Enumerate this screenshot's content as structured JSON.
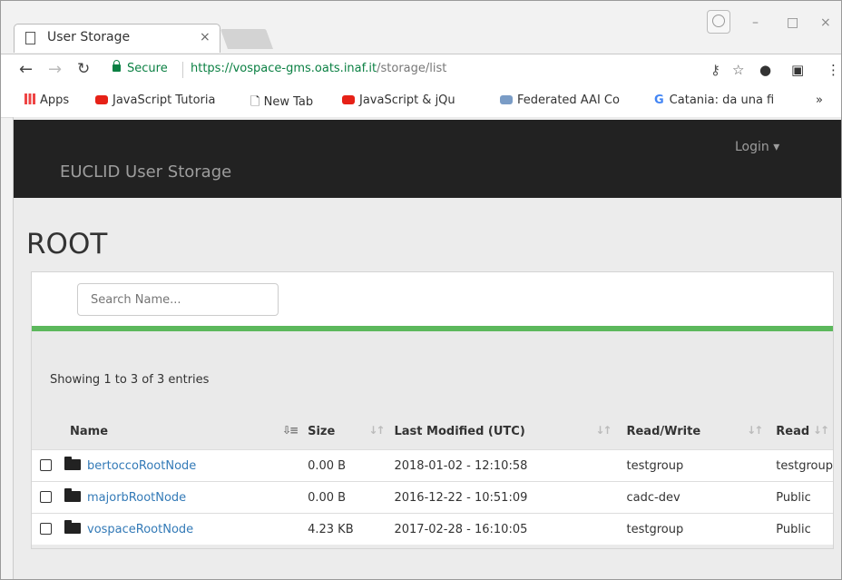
{
  "browser": {
    "tab_title": "User Storage",
    "tab_close": "×",
    "minimize": "–",
    "maximize": "□",
    "close": "×",
    "secure_label": "Secure",
    "url_host": "https://vospace-gms.oats.inaf.it",
    "url_path": "/storage/list",
    "bookmarks": [
      {
        "label": "Apps",
        "icon": "apps-icon"
      },
      {
        "label": "JavaScript Tutoria",
        "icon": "youtube-icon"
      },
      {
        "label": "New Tab",
        "icon": "page-icon"
      },
      {
        "label": "JavaScript & jQu",
        "icon": "youtube-icon"
      },
      {
        "label": "Federated AAI Co",
        "icon": "cloud-icon"
      },
      {
        "label": "Catania: da una fi",
        "icon": "g-icon"
      }
    ],
    "more_bookmarks": "»"
  },
  "navbar": {
    "brand": "EUCLID User Storage",
    "login": "Login ▾"
  },
  "page": {
    "title": "ROOT",
    "search_placeholder": "Search Name...",
    "progress_percent": 100,
    "showing": "Showing 1 to 3 of 3 entries"
  },
  "table": {
    "headers": {
      "name": "Name",
      "size": "Size",
      "modified": "Last Modified (UTC)",
      "readwrite": "Read/Write",
      "read": "Read"
    },
    "rows": [
      {
        "name": "bertoccoRootNode",
        "size": "0.00 B",
        "modified": "2018-01-02 - 12:10:58",
        "readwrite": "testgroup",
        "read": "testgroup"
      },
      {
        "name": "majorbRootNode",
        "size": "0.00 B",
        "modified": "2016-12-22 - 10:51:09",
        "readwrite": "cadc-dev",
        "read": "Public"
      },
      {
        "name": "vospaceRootNode",
        "size": "4.23 KB",
        "modified": "2017-02-28 - 16:10:05",
        "readwrite": "testgroup",
        "read": "Public"
      }
    ]
  },
  "colors": {
    "navbar_bg": "#222222",
    "progress": "#5cb85c",
    "link": "#337ab7",
    "secure_green": "#0b8043"
  }
}
